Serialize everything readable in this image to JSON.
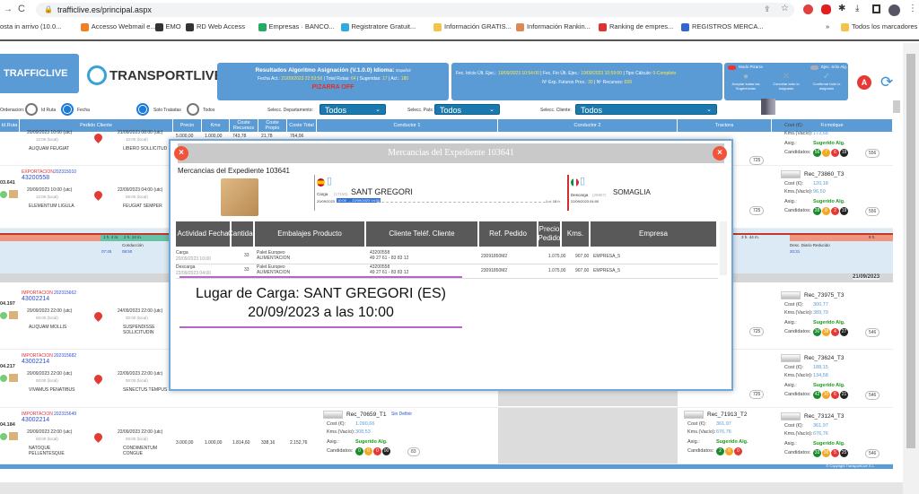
{
  "browser": {
    "url": "trafficlive.es/principal.aspx",
    "bookmarks": [
      "osta in arrivo (10.0...",
      "Accesso Webmail e...",
      "EMO",
      "RD Web Access",
      "Empresas · BANCO...",
      "Registratore Gratuit...",
      "Información GRATIS...",
      "Información Rankin...",
      "Ranking de empres...",
      "REGISTROS MERCA..."
    ],
    "all_bookmarks": "Todos los marcadores"
  },
  "header": {
    "brand1": "TRAFFICLIVE",
    "brand2": "TRANSPORTLIVE",
    "results_title": "Resultados Algoritmo Asignación (V.1.0.0)",
    "idioma_label": "Idioma:",
    "idioma": "Español",
    "fecha_label": "Fecha Act.:",
    "fecha": "21/09/2023 22:53:56",
    "rutas_label": "| Total Rutas:",
    "rutas": "64",
    "sugeridas_label": "| Sugeridas:",
    "sugeridas": "17",
    "act_label": "| Act.:",
    "act": "180",
    "pizarra": "PIZARRA OFF",
    "inicio_label": "Fec. Inicio Últ. Ejec.:",
    "inicio": "19/09/2023 10:54:00",
    "fin_label": "| Fec. Fin Últ. Ejec.:",
    "fin": "19/09/2023 10:59:00",
    "tipo_label": "| Tipo Cálculo:",
    "tipo": "0-Completo",
    "exp_label": "Nº Exp. Futuros Prox.:",
    "exp": "30",
    "rec_label": "| Nº Recursos:",
    "rec": "699",
    "modo_pizarra": "Modo Pizarra",
    "ejec": "Ejec. Sólo Alg.",
    "aceptar": "Aceptar todas las Sugerencias",
    "cancelar": "Cancelar todo lo Asignado",
    "confirmar": "Confirmar todo lo asignado"
  },
  "filters": {
    "ordenacion": "Ordenacion:",
    "id_ruta": "Id Ruta",
    "fecha": "Fecha",
    "solo_tratadas": "Solo Tratadas",
    "todos": "Todos",
    "dep_label": "Selecc. Departamento:",
    "dep": "Todos",
    "pais_label": "Selecc. País:",
    "pais": "Todos",
    "cliente_label": "Selecc. Cliente:",
    "cliente": "Todos"
  },
  "columns": [
    "Id.Ruta",
    "Pedido Cliente",
    "Precio",
    "Kms",
    "Coste Recursos",
    "Coste Propio",
    "Coste Total",
    "Conductor 1",
    "Conductor 2",
    "Tractora",
    "Remolque"
  ],
  "rows": [
    {
      "id": "",
      "tipo": "",
      "exp": "",
      "pedido": "",
      "o_utc": "20/09/2023 10:00 (utc)",
      "o_loc": "12:00 (local)",
      "d_utc": "21/09/2023 08:00 (utc)",
      "d_loc": "10:00 (local)",
      "origen": "ALIQUAM FEUGIAT",
      "destino": "LIBERO SOLLICITUD",
      "precio": "5.000,00",
      "kms": "1.000,00",
      "cr": "743,78",
      "cp": "21,78",
      "ct": "764,06"
    },
    {
      "id": "03.641",
      "tipo": "EXPORTACION",
      "exp": "202315010",
      "pedido": "43200558",
      "o_utc": "20/09/2023 10:00 (utc)",
      "o_loc": "12:00 (local)",
      "d_utc": "22/09/2023 04:00 (utc)",
      "d_loc": "06:00 (local)",
      "origen": "ELEMENTUM LIGULA",
      "destino": "FEUGIAT SEMPER",
      "precio": "",
      "kms": "",
      "cr": "",
      "cp": "",
      "ct": ""
    },
    {
      "id": "04.197",
      "tipo": "IMPORTACION",
      "exp": "202315662",
      "pedido": "43002214",
      "o_utc": "20/09/2023 22:00 (utc)",
      "o_loc": "00:00 (local)",
      "d_utc": "24/09/2023 22:00 (utc)",
      "d_loc": "00:00 (local)",
      "origen": "ALIQUAM MOLLIS",
      "destino": "SUSPENDISSE SOLLICITUDIN",
      "precio": "",
      "kms": "",
      "cr": "",
      "cp": "",
      "ct": ""
    },
    {
      "id": "04.217",
      "tipo": "IMPORTACION",
      "exp": "202315682",
      "pedido": "43002214",
      "o_utc": "20/09/2023 22:00 (utc)",
      "o_loc": "00:00 (local)",
      "d_utc": "22/09/2023 22:00 (utc)",
      "d_loc": "00:00 (local)",
      "origen": "VIVAMUS PENATIBUS",
      "destino": "SENECTUS TEMPUS",
      "precio": "",
      "kms": "",
      "cr": "",
      "cp": "",
      "ct": ""
    },
    {
      "id": "04.184",
      "tipo": "IMPORTACION",
      "exp": "202315649",
      "pedido": "43002214",
      "o_utc": "20/09/2023 22:00 (utc)",
      "o_loc": "00:00 (local)",
      "d_utc": "22/09/2023 22:00 (utc)",
      "d_loc": "00:00 (local)",
      "origen": "NATOQUE PELLENTESQUE",
      "destino": "CONDIMENTUM CONGUE",
      "precio": "3.000,00",
      "kms": "1.000,00",
      "cr": "1.814,60",
      "cp": "338,16",
      "ct": "2.152,76"
    }
  ],
  "labels": {
    "cost": "Cost (€):",
    "kms": "Kms.(Vacío):",
    "asig": "Asig.:",
    "cand": "Candidatos:",
    "sugerido": "Sugerido Alg."
  },
  "remolques": [
    {
      "name": "",
      "cost": "112,54",
      "kms": "173,68",
      "c": [
        "56",
        "7",
        "6",
        "19"
      ],
      "n": "556"
    },
    {
      "name": "Rec_73860_T3",
      "cost": "120,18",
      "kms": "96,50",
      "c": [
        "28",
        "8",
        "2",
        "19"
      ],
      "n": "556"
    },
    {
      "name": "Rec_73975_T3",
      "cost": "300,77",
      "kms": "389,79",
      "c": [
        "30",
        "38",
        "4",
        "27"
      ],
      "n": "546"
    },
    {
      "name": "Rec_73624_T3",
      "cost": "188,15",
      "kms": "134,58",
      "c": [
        "42",
        "10",
        "6",
        "21"
      ],
      "n": "546"
    },
    {
      "name": "Rec_73124_T3",
      "cost": "361,97",
      "kms": "676,76",
      "c": [
        "33",
        "38",
        "5",
        "25"
      ],
      "n": "546"
    }
  ],
  "conductor": {
    "name": "Rec_70659_T1",
    "sin": "Sin Definir",
    "cost": "1.090,66",
    "kms": "308,53",
    "c": [
      "0",
      "0",
      "0",
      "00"
    ],
    "n": "83"
  },
  "tractora": {
    "name": "Rec_71913_T2",
    "cost": "361,97",
    "kms": "676,76",
    "c": [
      "2",
      "0",
      "0"
    ],
    "pill": "725"
  },
  "timeline": {
    "t1": "1 h. 4 m.",
    "t2": "2 h. 14 m.",
    "cond": "Conducción",
    "h1": "07:45",
    "h2": "08:50",
    "t3": "3 h. 44 m.",
    "t4": "9 h.",
    "desc": "Desc. Diario Reducido",
    "h3": "20:31",
    "date": "21/09/2023"
  },
  "modal": {
    "title": "Mercancias del Expediente 103641",
    "subtitle": "Mercancias del Expediente 103641",
    "carga_label": "Carga",
    "carga_cp": "(17150)",
    "carga_city": "SANT GREGORI",
    "carga_date": "20/09/2023",
    "carga_hl": "10:00 → 22/09/2023 04:00",
    "dist": "1 d. 18 h.",
    "desc_label": "Descarga",
    "desc_cp": "(26867)",
    "desc_city": "SOMAGLIA",
    "desc_date": "22/09/2023 04:00",
    "headers": [
      "Actividad Fecha",
      "Cantidad",
      "Embalajes Producto",
      "Cliente Teléf. Cliente",
      "Ref. Pedido",
      "Precio Pedido",
      "Kms.",
      "Empresa"
    ],
    "rows": [
      {
        "act": "Carga",
        "fecha": "20/09/2023 10:00",
        "cant": "33",
        "emb": "Palet Europeo",
        "prod": "ALIMENTACION",
        "cli": "43200558",
        "tel": "49 27 61 - 83 83 12",
        "ref": "23091850M2",
        "precio": "1.075,00",
        "kms": "907,00",
        "emp": "EMPRESA_5"
      },
      {
        "act": "Descarga",
        "fecha": "22/09/2023 04:00",
        "cant": "33",
        "emb": "Palet Europeo",
        "prod": "ALIMENTACION",
        "cli": "43200558",
        "tel": "49 27 61 - 83 83 12",
        "ref": "23091850M2",
        "precio": "1.075,00",
        "kms": "907,00",
        "emp": "EMPRESA_5"
      }
    ],
    "lugar": "Lugar de Carga: SANT GREGORI (ES)",
    "fecha_hora": "20/09/2023 a las 10:00"
  },
  "footer": "© Copyright TransportLive S.L."
}
